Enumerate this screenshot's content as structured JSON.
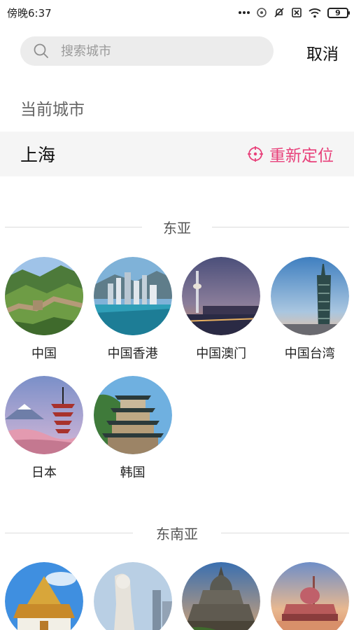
{
  "status_bar": {
    "time": "傍晚6:37",
    "battery": "9"
  },
  "search": {
    "placeholder": "搜索城市",
    "cancel_label": "取消"
  },
  "current_city": {
    "section_label": "当前城市",
    "name": "上海",
    "relocate_label": "重新定位"
  },
  "regions": [
    {
      "title": "东亚",
      "items": [
        {
          "label": "中国",
          "icon": "great-wall-photo"
        },
        {
          "label": "中国香港",
          "icon": "hong-kong-skyline-photo"
        },
        {
          "label": "中国澳门",
          "icon": "macau-tower-photo"
        },
        {
          "label": "中国台湾",
          "icon": "taipei-101-photo"
        },
        {
          "label": "日本",
          "icon": "fuji-pagoda-photo"
        },
        {
          "label": "韩国",
          "icon": "korean-pagoda-photo"
        }
      ]
    },
    {
      "title": "东南亚",
      "items": [
        {
          "label": "",
          "icon": "thai-temple-photo"
        },
        {
          "label": "",
          "icon": "merlion-photo"
        },
        {
          "label": "",
          "icon": "borobudur-photo"
        },
        {
          "label": "",
          "icon": "putra-mosque-photo"
        }
      ]
    }
  ],
  "colors": {
    "accent": "#e8407a",
    "search_bg": "#ececec",
    "current_city_bg": "#f5f5f5"
  }
}
